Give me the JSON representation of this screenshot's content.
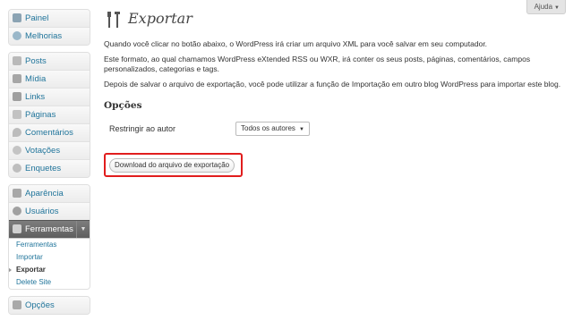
{
  "help": {
    "label": "Ajuda",
    "arrow": "▼"
  },
  "sidebar": {
    "groups": [
      {
        "items": [
          {
            "label": "Painel",
            "icon": "dashboard-icon"
          },
          {
            "label": "Melhorias",
            "icon": "updates-icon"
          }
        ]
      },
      {
        "items": [
          {
            "label": "Posts",
            "icon": "posts-icon"
          },
          {
            "label": "Mídia",
            "icon": "media-icon"
          },
          {
            "label": "Links",
            "icon": "links-icon"
          },
          {
            "label": "Páginas",
            "icon": "pages-icon"
          },
          {
            "label": "Comentários",
            "icon": "comments-icon"
          },
          {
            "label": "Votações",
            "icon": "votes-icon"
          },
          {
            "label": "Enquetes",
            "icon": "polls-icon"
          }
        ]
      },
      {
        "items": [
          {
            "label": "Aparência",
            "icon": "appearance-icon"
          },
          {
            "label": "Usuários",
            "icon": "users-icon"
          },
          {
            "label": "Ferramentas",
            "icon": "tools-icon",
            "toggle": "▼"
          }
        ]
      }
    ],
    "submenu": [
      {
        "label": "Ferramentas"
      },
      {
        "label": "Importar"
      },
      {
        "label": "Exportar"
      },
      {
        "label": "Delete Site"
      }
    ],
    "last": {
      "label": "Opções",
      "icon": "settings-icon"
    }
  },
  "main": {
    "title": "Exportar",
    "paragraphs": [
      "Quando você clicar no botão abaixo, o WordPress irá criar um arquivo XML para você salvar em seu computador.",
      "Este formato, ao qual chamamos WordPress eXtended RSS ou WXR, irá conter os seus posts, páginas, comentários, campos personalizados, categorias e tags.",
      "Depois de salvar o arquivo de exportação, você pode utilizar a função de Importação em outro blog WordPress para importar este blog."
    ],
    "options_title": "Opções",
    "author_label": "Restringir ao autor",
    "author_select": "Todos os autores",
    "author_caret": "▼",
    "download_button": "Download do arquivo de exportação"
  },
  "colors": {
    "link": "#21759b",
    "highlight": "#e11d1d",
    "current_menu": "#6e6e6e"
  }
}
